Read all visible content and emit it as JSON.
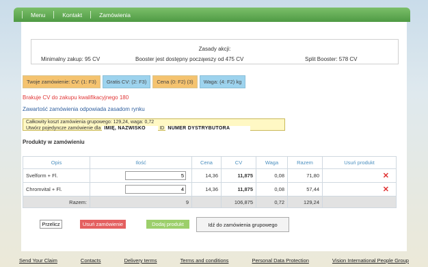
{
  "nav": {
    "items": [
      "Menu",
      "Kontakt",
      "Zamówienia"
    ]
  },
  "rules": {
    "title": "Zasady akcji:",
    "min_purchase": "Minimalny zakup: 95 CV",
    "booster": "Booster jest dostępny począwszy od 475 CV",
    "split": "Split Booster: 578 CV"
  },
  "tabs": [
    "Twoje zamówienie: CV: (1: F3)",
    "Gratis CV: (2: F3)",
    "Cena (0: F2) (3)",
    "Waga: (4: F2) kg"
  ],
  "messages": {
    "missing": "Brakuje CV do zakupu kwalifikacyjnego 180",
    "compliance": "Zawartość zamówienia odpowiada zasadom rynku"
  },
  "cart": {
    "line1": "Całkowity koszt zamówienia grupowego: 129,24, waga: 0,72",
    "line2_prefix": "Utwórz pojedyncze zamówienie dla",
    "name_field": "IMIĘ, NAZWISKO",
    "id_label": "ID",
    "id_field": "NUMER DYSTRYBUTORA"
  },
  "products": {
    "title": "Produkty w zamówieniu",
    "headers": [
      "Opis",
      "Ilość",
      "Cena",
      "CV",
      "Waga",
      "Razem",
      "Usuń produkt"
    ],
    "rows": [
      {
        "desc": "Svelform + Fl.",
        "qty": "5",
        "price": "14,36",
        "cv": "11,875",
        "weight": "0,08",
        "total": "71,80"
      },
      {
        "desc": "Chromvital + Fl.",
        "qty": "4",
        "price": "14,36",
        "cv": "11,875",
        "weight": "0,08",
        "total": "57,44"
      }
    ],
    "total": {
      "label": "Razem:",
      "qty": "9",
      "cv": "106,875",
      "weight": "0,72",
      "total": "129,24"
    }
  },
  "buttons": {
    "recalc": "Przelicz",
    "clear": "Usuń zamówienie",
    "add": "Dodaj produkt",
    "group": "Idź do zamówienia grupowego"
  },
  "footer": [
    "Send Your Claim",
    "Contacts",
    "Delivery terms",
    "Terms and conditions",
    "Personal Data Protection",
    "Vision International People Group"
  ]
}
